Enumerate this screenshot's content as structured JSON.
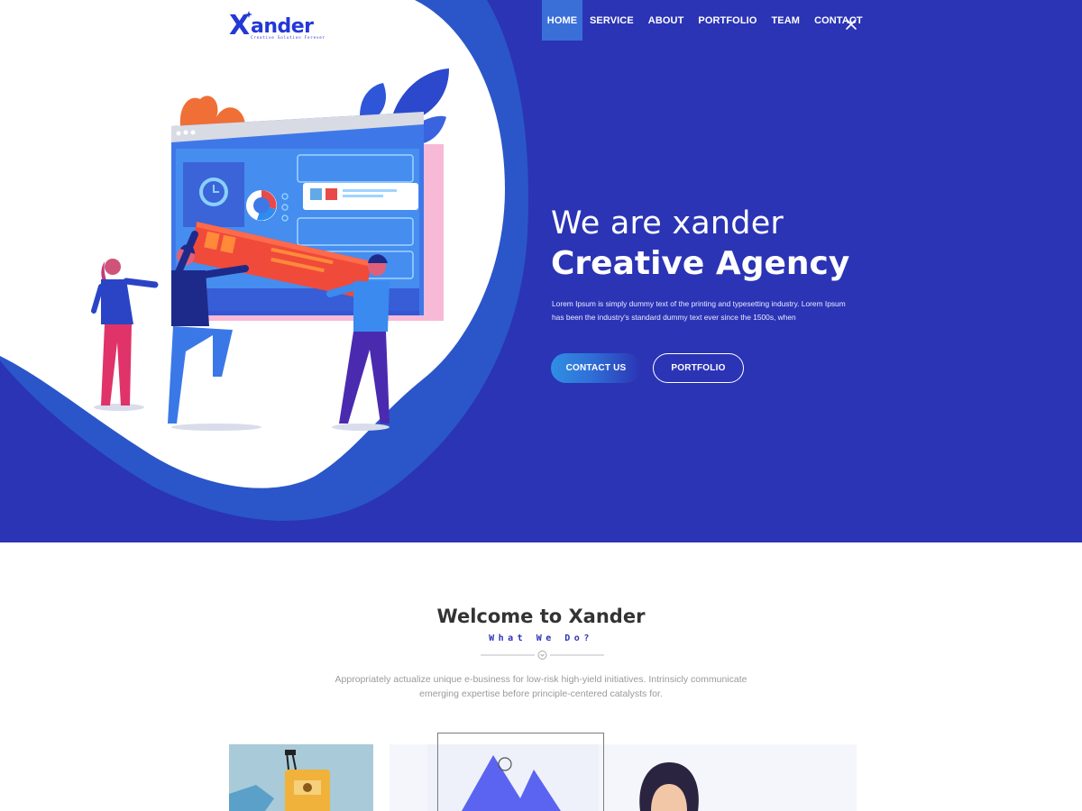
{
  "brand": {
    "name": "ander",
    "mark": "X",
    "tagline": "Creative Solution Forever"
  },
  "nav": {
    "items": [
      {
        "label": "HOME",
        "active": true
      },
      {
        "label": "SERVICE"
      },
      {
        "label": "ABOUT"
      },
      {
        "label": "PORTFOLIO"
      },
      {
        "label": "TEAM"
      },
      {
        "label": "CONTACT"
      }
    ],
    "close_icon": "close-icon"
  },
  "hero": {
    "title_line1": "We are xander",
    "title_line2": "Creative Agency",
    "description": "Lorem Ipsum is simply dummy text of the printing and typesetting industry. Lorem Ipsum has been the industry's standard dummy text ever since the 1500s, when",
    "buttons": {
      "contact": "CONTACT US",
      "portfolio": "PORTFOLIO"
    }
  },
  "welcome": {
    "title": "Welcome to Xander",
    "subtitle": "What We Do?",
    "description": "Appropriately actualize unique e-business for low-risk high-yield initiatives. Intrinsicly communicate emerging expertise before principle-centered catalysts for."
  },
  "colors": {
    "hero_bg": "#2b34b5",
    "accent_blue": "#2438d6",
    "nav_active": "#3a6fd8",
    "text_dark": "#333333",
    "text_muted": "#9a9a9a"
  }
}
